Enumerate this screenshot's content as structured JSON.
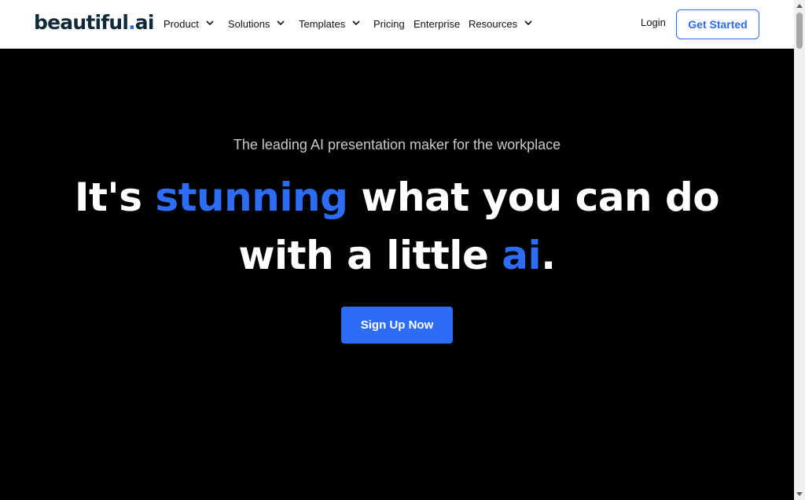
{
  "header": {
    "logo": {
      "text_main": "beautiful",
      "text_dot": ".",
      "text_ai": "ai"
    },
    "nav": [
      {
        "label": "Product",
        "has_dropdown": true
      },
      {
        "label": "Solutions",
        "has_dropdown": true
      },
      {
        "label": "Templates",
        "has_dropdown": true
      },
      {
        "label": "Pricing",
        "has_dropdown": false
      },
      {
        "label": "Enterprise",
        "has_dropdown": false
      },
      {
        "label": "Resources",
        "has_dropdown": true
      }
    ],
    "login_label": "Login",
    "cta_label": "Get Started"
  },
  "hero": {
    "tagline": "The leading AI presentation maker for the workplace",
    "headline": {
      "part1": "It's ",
      "highlight1": "stunning",
      "part2": " what you can do",
      "part3": "with a little ",
      "highlight2": "ai",
      "part4": "."
    },
    "cta_label": "Sign Up Now"
  },
  "colors": {
    "accent": "#2d6df6",
    "logo_dark": "#112a3a",
    "background": "#000000"
  },
  "icons": {
    "dropdown": "chevron-down-icon"
  }
}
